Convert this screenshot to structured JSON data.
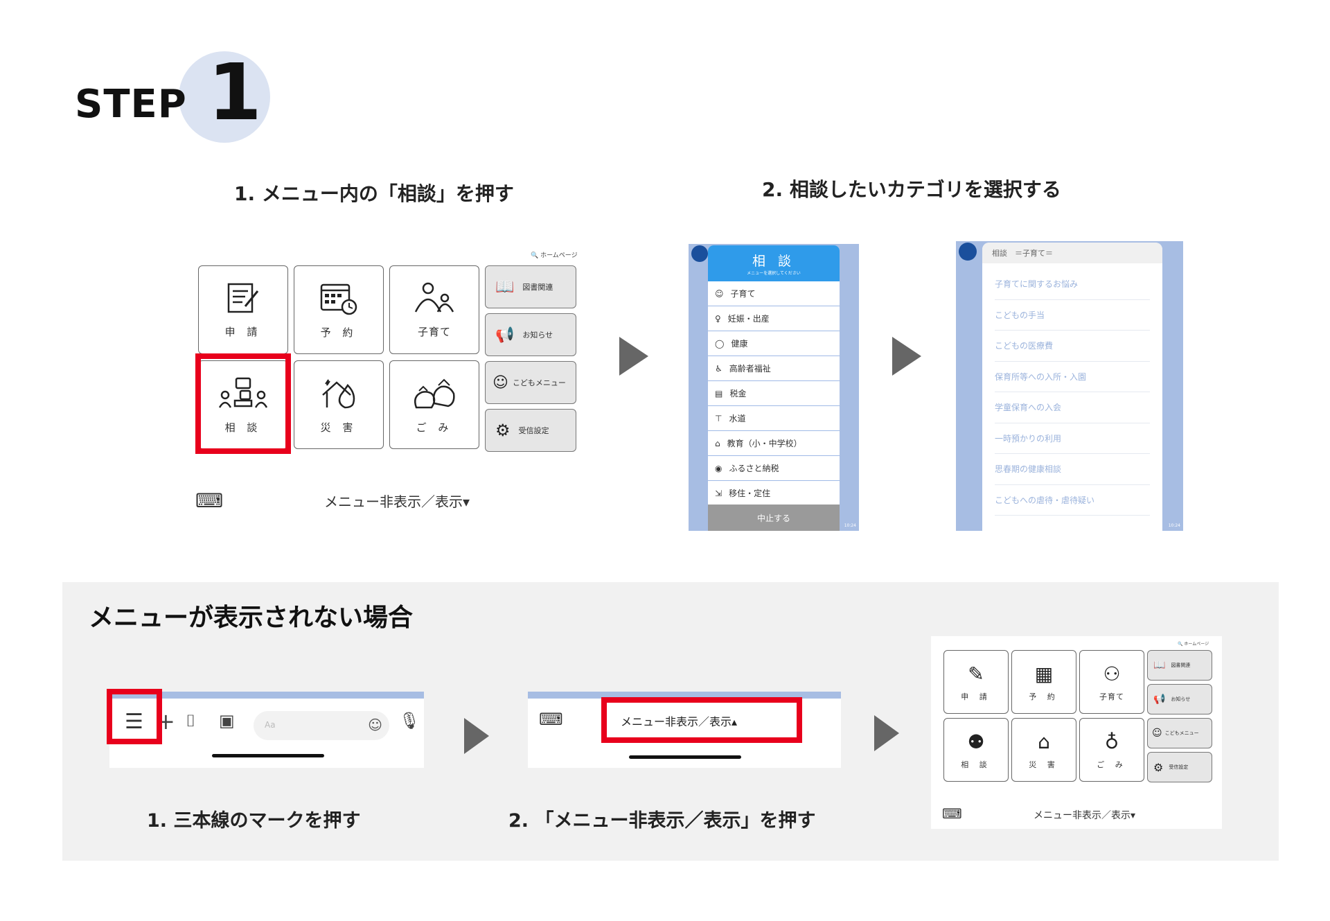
{
  "step": {
    "word": "STEP",
    "number": "1"
  },
  "headings": {
    "h1": "1. メニュー内の「相談」を押す",
    "h2": "2. 相談したいカテゴリを選択する"
  },
  "menu": {
    "homepage": "ホームページ",
    "items": [
      "申 請",
      "予 約",
      "子育て",
      "相 談",
      "災 害",
      "ご み"
    ],
    "side": [
      "図書関連",
      "お知らせ",
      "こどもメニュー",
      "受信設定"
    ],
    "toggle": "メニュー非表示／表示▾"
  },
  "consult": {
    "title": "相 談",
    "subtitle": "メニューを選択してください",
    "items": [
      "子育て",
      "妊娠・出産",
      "健康",
      "高齢者福祉",
      "税金",
      "水道",
      "教育（小・中学校）",
      "ふるさと納税",
      "移住・定住"
    ],
    "cancel": "中止する",
    "time": "10:24"
  },
  "childcare": {
    "header": "相談　＝子育て＝",
    "items": [
      "子育てに関するお悩み",
      "こどもの手当",
      "こどもの医療費",
      "保育所等への入所・入園",
      "学童保育への入会",
      "一時預かりの利用",
      "思春期の健康相談",
      "こどもへの虐待・虐待疑い"
    ],
    "time": "10:24"
  },
  "missing": {
    "title": "メニューが表示されない場合",
    "caption1": "1. 三本線のマークを押す",
    "caption2": "2. 「メニュー非表示／表示」を押す",
    "input_placeholder": "Aa",
    "toggle_up": "メニュー非表示／表示▴"
  },
  "colors": {
    "accent_red": "#e8001c",
    "step_circle": "#dbe3f2",
    "phone_bg": "#a7bde3",
    "consult_header": "#2f9bea"
  }
}
